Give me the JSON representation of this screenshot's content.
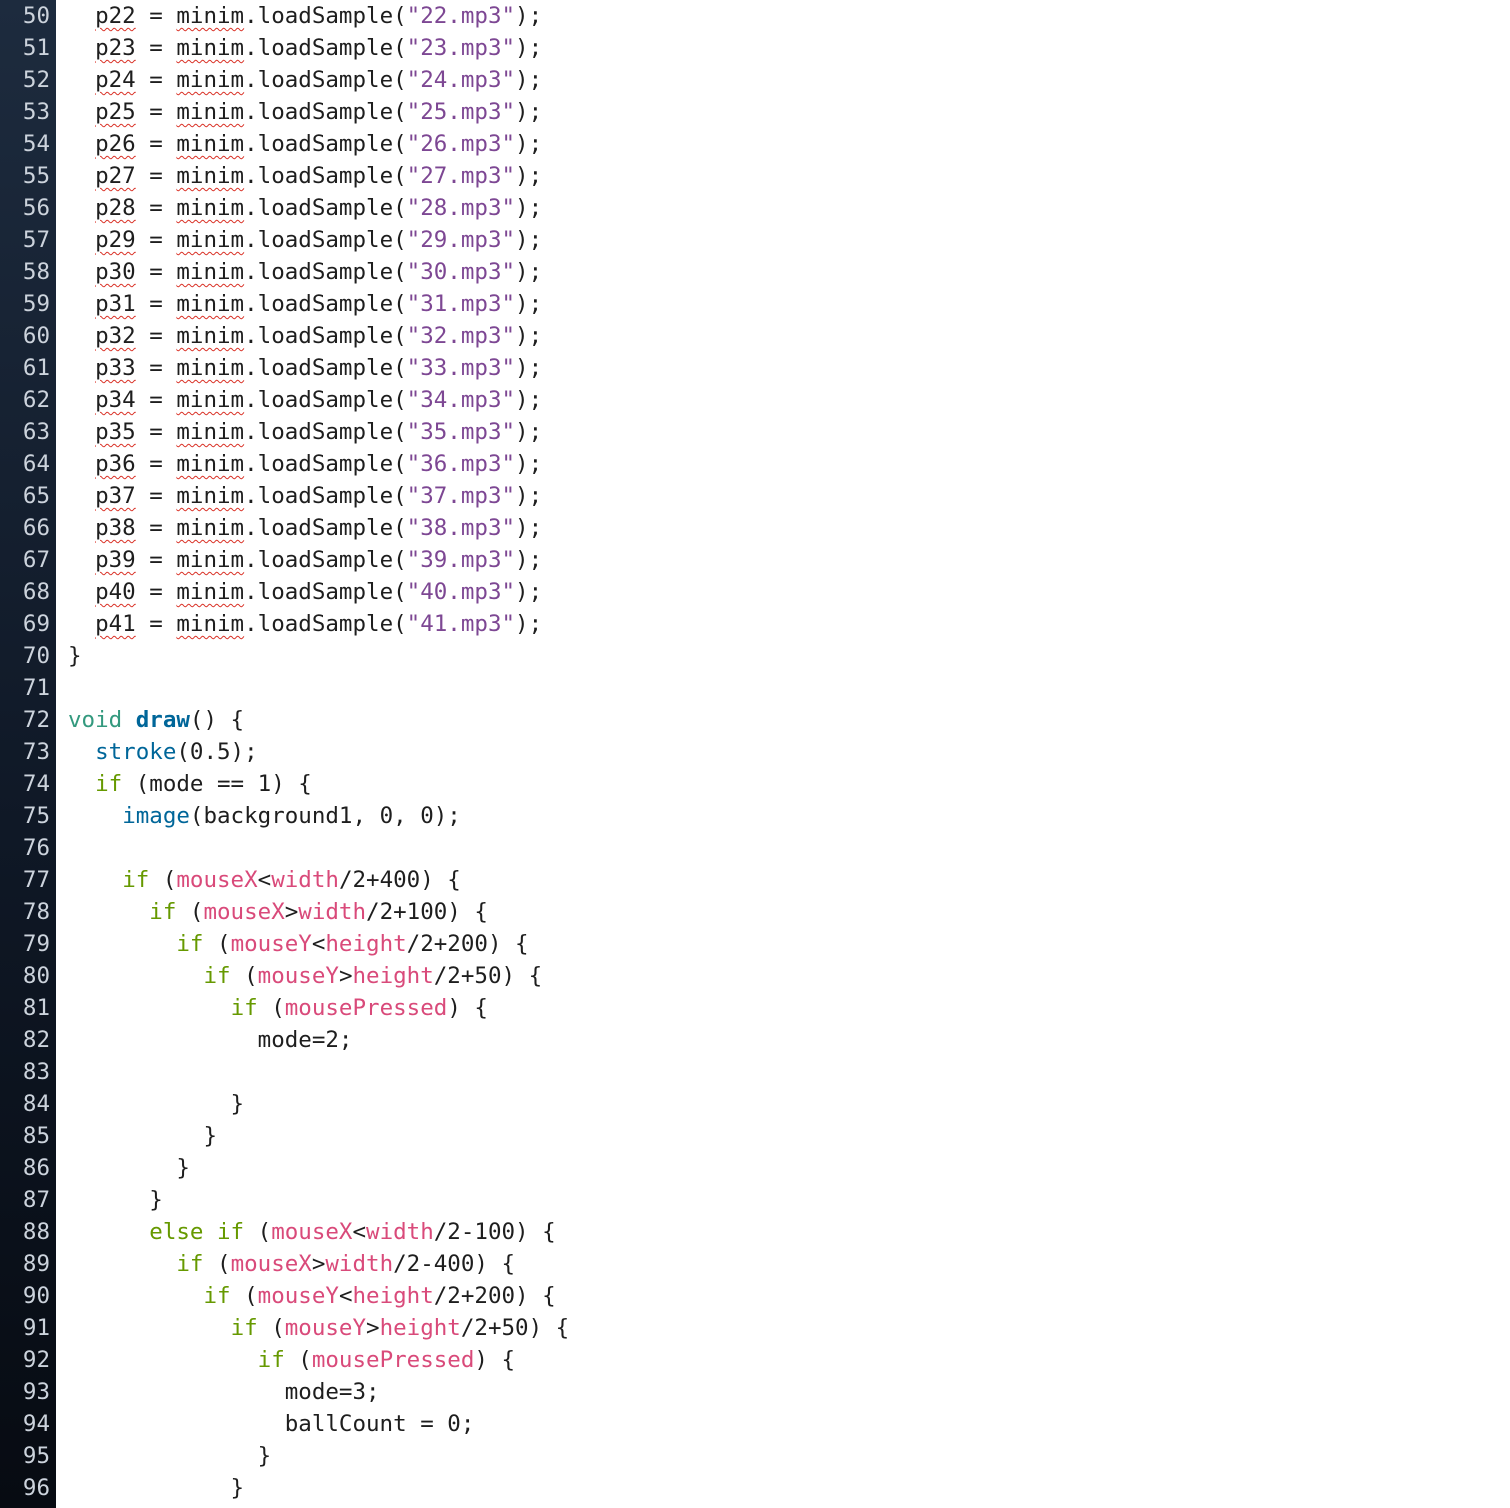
{
  "colors": {
    "gutter_bg": "#0f1826",
    "line_number": "#ccd3dc",
    "text": "#1e1e1e",
    "keyword": "#33997e",
    "control": "#669900",
    "function": "#006699",
    "builtin_variable": "#d94a7a",
    "string": "#7d4793",
    "error_squiggle": "#d93025"
  },
  "lines": [
    {
      "n": "50",
      "tokens": [
        {
          "t": "  "
        },
        {
          "t": "p22",
          "c": "err"
        },
        {
          "t": " = "
        },
        {
          "t": "minim",
          "c": "err"
        },
        {
          "t": ".loadSample("
        },
        {
          "t": "\"22.mp3\"",
          "c": "str"
        },
        {
          "t": ");"
        }
      ]
    },
    {
      "n": "51",
      "tokens": [
        {
          "t": "  "
        },
        {
          "t": "p23",
          "c": "err"
        },
        {
          "t": " = "
        },
        {
          "t": "minim",
          "c": "err"
        },
        {
          "t": ".loadSample("
        },
        {
          "t": "\"23.mp3\"",
          "c": "str"
        },
        {
          "t": ");"
        }
      ]
    },
    {
      "n": "52",
      "tokens": [
        {
          "t": "  "
        },
        {
          "t": "p24",
          "c": "err"
        },
        {
          "t": " = "
        },
        {
          "t": "minim",
          "c": "err"
        },
        {
          "t": ".loadSample("
        },
        {
          "t": "\"24.mp3\"",
          "c": "str"
        },
        {
          "t": ");"
        }
      ]
    },
    {
      "n": "53",
      "tokens": [
        {
          "t": "  "
        },
        {
          "t": "p25",
          "c": "err"
        },
        {
          "t": " = "
        },
        {
          "t": "minim",
          "c": "err"
        },
        {
          "t": ".loadSample("
        },
        {
          "t": "\"25.mp3\"",
          "c": "str"
        },
        {
          "t": ");"
        }
      ]
    },
    {
      "n": "54",
      "tokens": [
        {
          "t": "  "
        },
        {
          "t": "p26",
          "c": "err"
        },
        {
          "t": " = "
        },
        {
          "t": "minim",
          "c": "err"
        },
        {
          "t": ".loadSample("
        },
        {
          "t": "\"26.mp3\"",
          "c": "str"
        },
        {
          "t": ");"
        }
      ]
    },
    {
      "n": "55",
      "tokens": [
        {
          "t": "  "
        },
        {
          "t": "p27",
          "c": "err"
        },
        {
          "t": " = "
        },
        {
          "t": "minim",
          "c": "err"
        },
        {
          "t": ".loadSample("
        },
        {
          "t": "\"27.mp3\"",
          "c": "str"
        },
        {
          "t": ");"
        }
      ]
    },
    {
      "n": "56",
      "tokens": [
        {
          "t": "  "
        },
        {
          "t": "p28",
          "c": "err"
        },
        {
          "t": " = "
        },
        {
          "t": "minim",
          "c": "err"
        },
        {
          "t": ".loadSample("
        },
        {
          "t": "\"28.mp3\"",
          "c": "str"
        },
        {
          "t": ");"
        }
      ]
    },
    {
      "n": "57",
      "tokens": [
        {
          "t": "  "
        },
        {
          "t": "p29",
          "c": "err"
        },
        {
          "t": " = "
        },
        {
          "t": "minim",
          "c": "err"
        },
        {
          "t": ".loadSample("
        },
        {
          "t": "\"29.mp3\"",
          "c": "str"
        },
        {
          "t": ");"
        }
      ]
    },
    {
      "n": "58",
      "tokens": [
        {
          "t": "  "
        },
        {
          "t": "p30",
          "c": "err"
        },
        {
          "t": " = "
        },
        {
          "t": "minim",
          "c": "err"
        },
        {
          "t": ".loadSample("
        },
        {
          "t": "\"30.mp3\"",
          "c": "str"
        },
        {
          "t": ");"
        }
      ]
    },
    {
      "n": "59",
      "tokens": [
        {
          "t": "  "
        },
        {
          "t": "p31",
          "c": "err"
        },
        {
          "t": " = "
        },
        {
          "t": "minim",
          "c": "err"
        },
        {
          "t": ".loadSample("
        },
        {
          "t": "\"31.mp3\"",
          "c": "str"
        },
        {
          "t": ");"
        }
      ]
    },
    {
      "n": "60",
      "tokens": [
        {
          "t": "  "
        },
        {
          "t": "p32",
          "c": "err"
        },
        {
          "t": " = "
        },
        {
          "t": "minim",
          "c": "err"
        },
        {
          "t": ".loadSample("
        },
        {
          "t": "\"32.mp3\"",
          "c": "str"
        },
        {
          "t": ");"
        }
      ]
    },
    {
      "n": "61",
      "tokens": [
        {
          "t": "  "
        },
        {
          "t": "p33",
          "c": "err"
        },
        {
          "t": " = "
        },
        {
          "t": "minim",
          "c": "err"
        },
        {
          "t": ".loadSample("
        },
        {
          "t": "\"33.mp3\"",
          "c": "str"
        },
        {
          "t": ");"
        }
      ]
    },
    {
      "n": "62",
      "tokens": [
        {
          "t": "  "
        },
        {
          "t": "p34",
          "c": "err"
        },
        {
          "t": " = "
        },
        {
          "t": "minim",
          "c": "err"
        },
        {
          "t": ".loadSample("
        },
        {
          "t": "\"34.mp3\"",
          "c": "str"
        },
        {
          "t": ");"
        }
      ]
    },
    {
      "n": "63",
      "tokens": [
        {
          "t": "  "
        },
        {
          "t": "p35",
          "c": "err"
        },
        {
          "t": " = "
        },
        {
          "t": "minim",
          "c": "err"
        },
        {
          "t": ".loadSample("
        },
        {
          "t": "\"35.mp3\"",
          "c": "str"
        },
        {
          "t": ");"
        }
      ]
    },
    {
      "n": "64",
      "tokens": [
        {
          "t": "  "
        },
        {
          "t": "p36",
          "c": "err"
        },
        {
          "t": " = "
        },
        {
          "t": "minim",
          "c": "err"
        },
        {
          "t": ".loadSample("
        },
        {
          "t": "\"36.mp3\"",
          "c": "str"
        },
        {
          "t": ");"
        }
      ]
    },
    {
      "n": "65",
      "tokens": [
        {
          "t": "  "
        },
        {
          "t": "p37",
          "c": "err"
        },
        {
          "t": " = "
        },
        {
          "t": "minim",
          "c": "err"
        },
        {
          "t": ".loadSample("
        },
        {
          "t": "\"37.mp3\"",
          "c": "str"
        },
        {
          "t": ");"
        }
      ]
    },
    {
      "n": "66",
      "tokens": [
        {
          "t": "  "
        },
        {
          "t": "p38",
          "c": "err"
        },
        {
          "t": " = "
        },
        {
          "t": "minim",
          "c": "err"
        },
        {
          "t": ".loadSample("
        },
        {
          "t": "\"38.mp3\"",
          "c": "str"
        },
        {
          "t": ");"
        }
      ]
    },
    {
      "n": "67",
      "tokens": [
        {
          "t": "  "
        },
        {
          "t": "p39",
          "c": "err"
        },
        {
          "t": " = "
        },
        {
          "t": "minim",
          "c": "err"
        },
        {
          "t": ".loadSample("
        },
        {
          "t": "\"39.mp3\"",
          "c": "str"
        },
        {
          "t": ");"
        }
      ]
    },
    {
      "n": "68",
      "tokens": [
        {
          "t": "  "
        },
        {
          "t": "p40",
          "c": "err"
        },
        {
          "t": " = "
        },
        {
          "t": "minim",
          "c": "err"
        },
        {
          "t": ".loadSample("
        },
        {
          "t": "\"40.mp3\"",
          "c": "str"
        },
        {
          "t": ");"
        }
      ]
    },
    {
      "n": "69",
      "tokens": [
        {
          "t": "  "
        },
        {
          "t": "p41",
          "c": "err"
        },
        {
          "t": " = "
        },
        {
          "t": "minim",
          "c": "err"
        },
        {
          "t": ".loadSample("
        },
        {
          "t": "\"41.mp3\"",
          "c": "str"
        },
        {
          "t": ");"
        }
      ]
    },
    {
      "n": "70",
      "tokens": [
        {
          "t": "}"
        }
      ]
    },
    {
      "n": "71",
      "tokens": []
    },
    {
      "n": "72",
      "tokens": [
        {
          "t": "void",
          "c": "kw"
        },
        {
          "t": " "
        },
        {
          "t": "draw",
          "c": "fnb"
        },
        {
          "t": "() {"
        }
      ]
    },
    {
      "n": "73",
      "tokens": [
        {
          "t": "  "
        },
        {
          "t": "stroke",
          "c": "fn"
        },
        {
          "t": "(0.5);"
        }
      ]
    },
    {
      "n": "74",
      "tokens": [
        {
          "t": "  "
        },
        {
          "t": "if",
          "c": "ctrl"
        },
        {
          "t": " (mode == 1) {"
        }
      ]
    },
    {
      "n": "75",
      "tokens": [
        {
          "t": "    "
        },
        {
          "t": "image",
          "c": "fn"
        },
        {
          "t": "(background1, 0, 0);"
        }
      ]
    },
    {
      "n": "76",
      "tokens": []
    },
    {
      "n": "77",
      "tokens": [
        {
          "t": "    "
        },
        {
          "t": "if",
          "c": "ctrl"
        },
        {
          "t": " ("
        },
        {
          "t": "mouseX",
          "c": "var"
        },
        {
          "t": "<"
        },
        {
          "t": "width",
          "c": "var"
        },
        {
          "t": "/2+400) {"
        }
      ]
    },
    {
      "n": "78",
      "tokens": [
        {
          "t": "      "
        },
        {
          "t": "if",
          "c": "ctrl"
        },
        {
          "t": " ("
        },
        {
          "t": "mouseX",
          "c": "var"
        },
        {
          "t": ">"
        },
        {
          "t": "width",
          "c": "var"
        },
        {
          "t": "/2+100) {"
        }
      ]
    },
    {
      "n": "79",
      "tokens": [
        {
          "t": "        "
        },
        {
          "t": "if",
          "c": "ctrl"
        },
        {
          "t": " ("
        },
        {
          "t": "mouseY",
          "c": "var"
        },
        {
          "t": "<"
        },
        {
          "t": "height",
          "c": "var"
        },
        {
          "t": "/2+200) {"
        }
      ]
    },
    {
      "n": "80",
      "tokens": [
        {
          "t": "          "
        },
        {
          "t": "if",
          "c": "ctrl"
        },
        {
          "t": " ("
        },
        {
          "t": "mouseY",
          "c": "var"
        },
        {
          "t": ">"
        },
        {
          "t": "height",
          "c": "var"
        },
        {
          "t": "/2+50) {"
        }
      ]
    },
    {
      "n": "81",
      "tokens": [
        {
          "t": "            "
        },
        {
          "t": "if",
          "c": "ctrl"
        },
        {
          "t": " ("
        },
        {
          "t": "mousePressed",
          "c": "var"
        },
        {
          "t": ") {"
        }
      ]
    },
    {
      "n": "82",
      "tokens": [
        {
          "t": "              mode=2;"
        }
      ]
    },
    {
      "n": "83",
      "tokens": []
    },
    {
      "n": "84",
      "tokens": [
        {
          "t": "            }"
        }
      ]
    },
    {
      "n": "85",
      "tokens": [
        {
          "t": "          }"
        }
      ]
    },
    {
      "n": "86",
      "tokens": [
        {
          "t": "        }"
        }
      ]
    },
    {
      "n": "87",
      "tokens": [
        {
          "t": "      }"
        }
      ]
    },
    {
      "n": "88",
      "tokens": [
        {
          "t": "      "
        },
        {
          "t": "else",
          "c": "ctrl"
        },
        {
          "t": " "
        },
        {
          "t": "if",
          "c": "ctrl"
        },
        {
          "t": " ("
        },
        {
          "t": "mouseX",
          "c": "var"
        },
        {
          "t": "<"
        },
        {
          "t": "width",
          "c": "var"
        },
        {
          "t": "/2-100) {"
        }
      ]
    },
    {
      "n": "89",
      "tokens": [
        {
          "t": "        "
        },
        {
          "t": "if",
          "c": "ctrl"
        },
        {
          "t": " ("
        },
        {
          "t": "mouseX",
          "c": "var"
        },
        {
          "t": ">"
        },
        {
          "t": "width",
          "c": "var"
        },
        {
          "t": "/2-400) {"
        }
      ]
    },
    {
      "n": "90",
      "tokens": [
        {
          "t": "          "
        },
        {
          "t": "if",
          "c": "ctrl"
        },
        {
          "t": " ("
        },
        {
          "t": "mouseY",
          "c": "var"
        },
        {
          "t": "<"
        },
        {
          "t": "height",
          "c": "var"
        },
        {
          "t": "/2+200) {"
        }
      ]
    },
    {
      "n": "91",
      "tokens": [
        {
          "t": "            "
        },
        {
          "t": "if",
          "c": "ctrl"
        },
        {
          "t": " ("
        },
        {
          "t": "mouseY",
          "c": "var"
        },
        {
          "t": ">"
        },
        {
          "t": "height",
          "c": "var"
        },
        {
          "t": "/2+50) {"
        }
      ]
    },
    {
      "n": "92",
      "tokens": [
        {
          "t": "              "
        },
        {
          "t": "if",
          "c": "ctrl"
        },
        {
          "t": " ("
        },
        {
          "t": "mousePressed",
          "c": "var"
        },
        {
          "t": ") {"
        }
      ]
    },
    {
      "n": "93",
      "tokens": [
        {
          "t": "                mode=3;"
        }
      ]
    },
    {
      "n": "94",
      "tokens": [
        {
          "t": "                ballCount = 0;"
        }
      ]
    },
    {
      "n": "95",
      "tokens": [
        {
          "t": "              }"
        }
      ]
    },
    {
      "n": "96",
      "tokens": [
        {
          "t": "            }"
        }
      ]
    }
  ]
}
